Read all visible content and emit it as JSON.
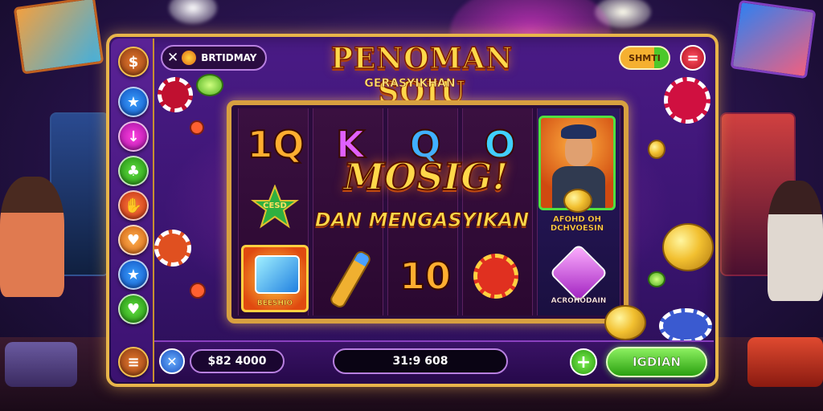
{
  "header": {
    "close_label": "✕",
    "player_name": "BRTIDMAY",
    "title": "PENOMAN SOIU",
    "subtitle": "GERASYIKHAN",
    "toggle_label": "SHMTI",
    "menu_icon": "menu-icon"
  },
  "reels": {
    "row1": [
      "1Q",
      "K",
      "Q",
      "O"
    ],
    "row3": [
      "10"
    ],
    "character_caption": "AFOHD OH DCHVOESIN",
    "bottom_tile_caption_left": "BEESHIO",
    "bottom_tile_caption_right": "ACROHODAIN",
    "badge_text": "CESD"
  },
  "win_banner": {
    "line1": "MOSIG!",
    "line2": "DAN MENGASYIKAN"
  },
  "sidebar": {
    "icons": [
      "logo-icon",
      "star-icon",
      "arrow-down-icon",
      "leaf-icon",
      "hand-icon",
      "heart-icon",
      "star-icon",
      "heart-icon",
      "menu-icon"
    ]
  },
  "footer": {
    "cancel_label": "✕",
    "balance": "$82 4000",
    "bet_display": "31:9 608",
    "plus_label": "+",
    "spin_label": "IGDIAN"
  },
  "colors": {
    "frame_gold": "#e8b54a",
    "panel_purple": "#4a1b86",
    "spin_green": "#4cc82a",
    "toggle_orange": "#f2a020",
    "close_red": "#e0283c"
  }
}
